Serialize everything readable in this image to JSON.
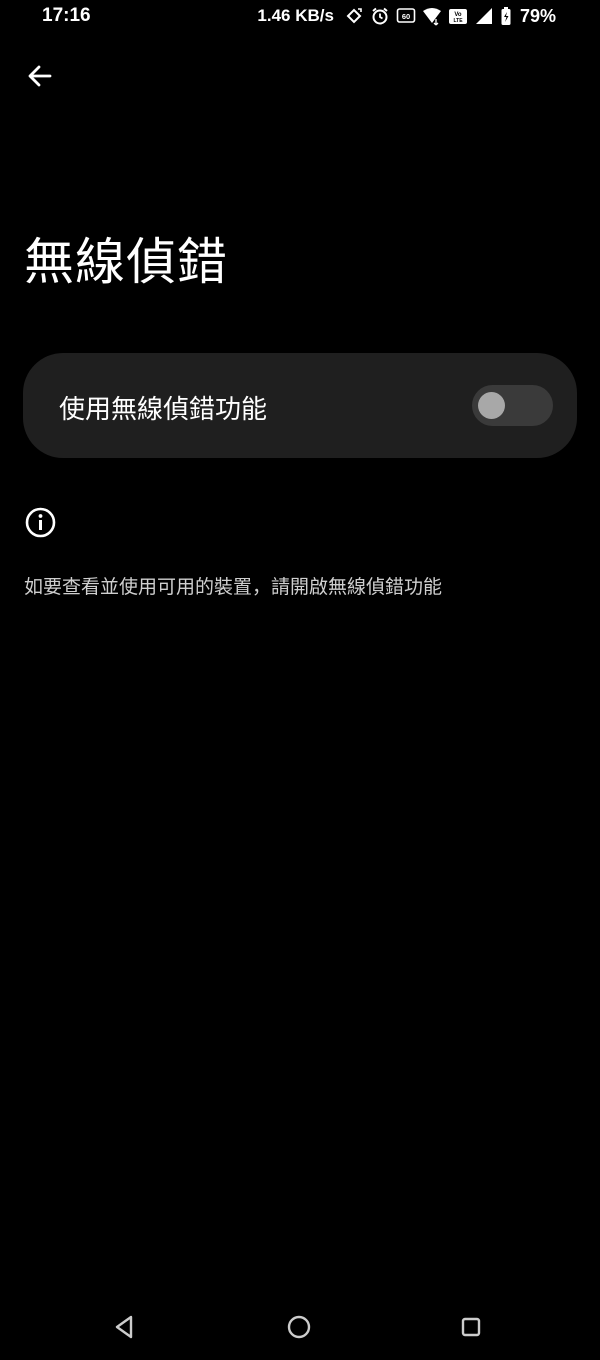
{
  "status_bar": {
    "time": "17:16",
    "net_speed": "1.46 KB/s",
    "battery": "79%",
    "icons": [
      "rotate-icon",
      "alarm-icon",
      "hd-voice-icon",
      "wifi-icon",
      "volte-icon",
      "signal-icon",
      "battery-icon"
    ]
  },
  "header": {
    "back_icon": "back-arrow-icon",
    "title": "無線偵錯"
  },
  "main_toggle": {
    "label": "使用無線偵錯功能",
    "enabled": false
  },
  "info": {
    "icon": "info-icon",
    "text": "如要查看並使用可用的裝置，請開啟無線偵錯功能"
  },
  "nav_bar": {
    "icons": [
      "nav-back-icon",
      "nav-home-icon",
      "nav-recents-icon"
    ]
  }
}
